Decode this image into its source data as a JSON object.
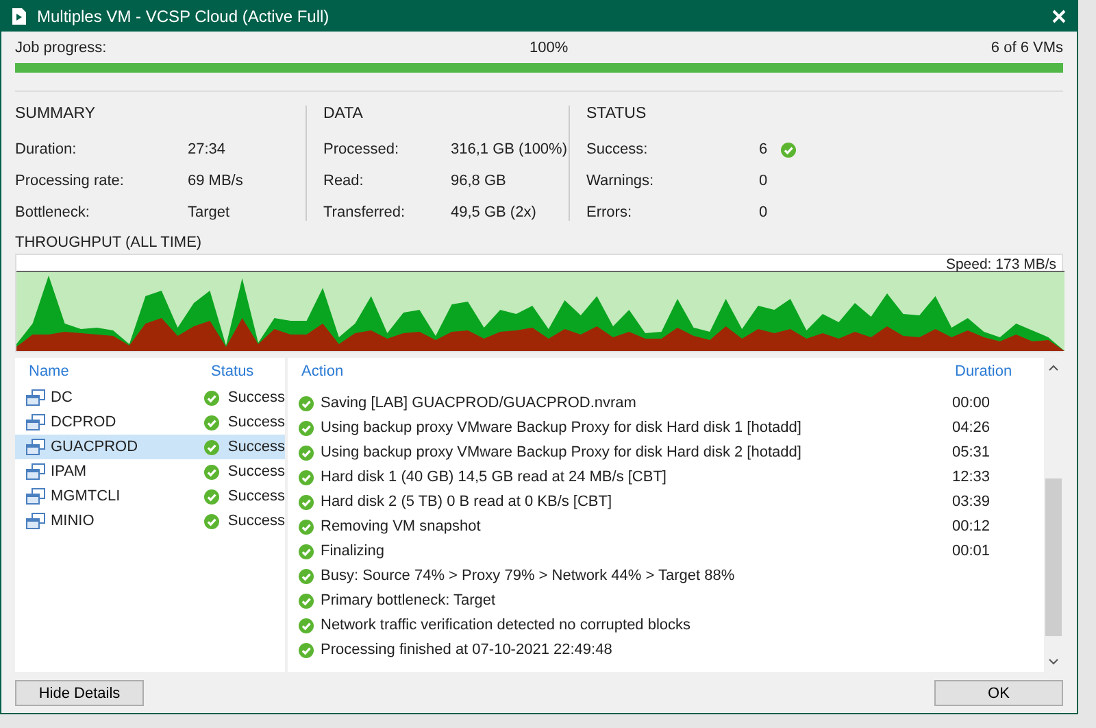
{
  "window": {
    "title": "Multiples VM - VCSP Cloud (Active Full)"
  },
  "job_progress": {
    "label": "Job progress:",
    "percent": "100%",
    "count": "6 of 6 VMs",
    "level": 1
  },
  "sections": [
    {
      "title": "SUMMARY",
      "rows": [
        {
          "label": "Duration:",
          "value": "27:34"
        },
        {
          "label": "Processing rate:",
          "value": "69 MB/s"
        },
        {
          "label": "Bottleneck:",
          "value": "Target"
        }
      ]
    },
    {
      "title": "DATA",
      "rows": [
        {
          "label": "Processed:",
          "value": "316,1 GB (100%)"
        },
        {
          "label": "Read:",
          "value": "96,8 GB"
        },
        {
          "label": "Transferred:",
          "value": "49,5 GB (2x)"
        }
      ]
    },
    {
      "title": "STATUS",
      "rows": [
        {
          "label": "Success:",
          "value": "6",
          "kind": "success"
        },
        {
          "label": "Warnings:",
          "value": "0"
        },
        {
          "label": "Errors:",
          "value": "0"
        }
      ]
    }
  ],
  "throughput": {
    "title": "THROUGHPUT (ALL TIME)",
    "speed": "Speed: 173 MB/s"
  },
  "vm_table": {
    "columns": [
      "Name",
      "Status"
    ],
    "rows": [
      {
        "name": "DC",
        "status": "Success",
        "selected": false
      },
      {
        "name": "DCPROD",
        "status": "Success",
        "selected": false
      },
      {
        "name": "GUACPROD",
        "status": "Success",
        "selected": true
      },
      {
        "name": "IPAM",
        "status": "Success",
        "selected": false
      },
      {
        "name": "MGMTCLI",
        "status": "Success",
        "selected": false
      },
      {
        "name": "MINIO",
        "status": "Success",
        "selected": false
      }
    ]
  },
  "action_table": {
    "columns": [
      "Action",
      "Duration"
    ],
    "rows": [
      {
        "action": "Saving [LAB] GUACPROD/GUACPROD.nvram",
        "duration": "00:00"
      },
      {
        "action": "Using backup proxy VMware Backup Proxy for disk Hard disk 1 [hotadd]",
        "duration": "04:26"
      },
      {
        "action": "Using backup proxy VMware Backup Proxy for disk Hard disk 2 [hotadd]",
        "duration": "05:31"
      },
      {
        "action": "Hard disk 1 (40 GB) 14,5 GB read at 24 MB/s [CBT]",
        "duration": "12:33"
      },
      {
        "action": "Hard disk 2 (5 TB) 0 B read at 0 KB/s [CBT]",
        "duration": "03:39"
      },
      {
        "action": "Removing VM snapshot",
        "duration": "00:12"
      },
      {
        "action": "Finalizing",
        "duration": "00:01"
      },
      {
        "action": "Busy: Source 74% > Proxy 79% > Network 44% > Target 88%"
      },
      {
        "action": "Primary bottleneck: Target"
      },
      {
        "action": "Network traffic verification detected no corrupted blocks"
      },
      {
        "action": "Processing finished at 07-10-2021 22:49:48"
      }
    ]
  },
  "buttons": {
    "left": "Hide Details",
    "right": "OK"
  }
}
